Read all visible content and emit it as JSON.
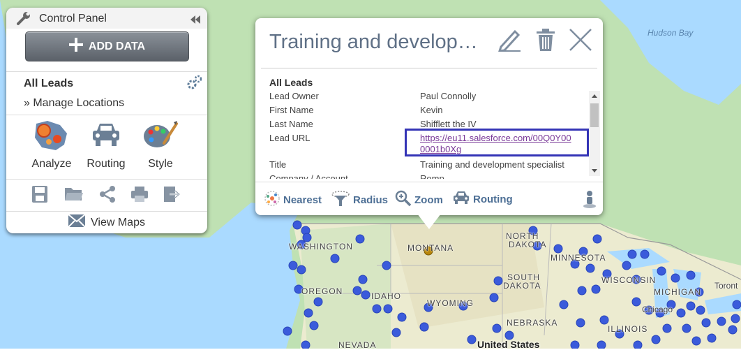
{
  "control_panel": {
    "title": "Control Panel",
    "add_data": "ADD DATA",
    "layer": "All Leads",
    "manage": "» Manage Locations",
    "tools": [
      {
        "label": "Analyze",
        "icon": "analyze-map-icon"
      },
      {
        "label": "Routing",
        "icon": "car-icon"
      },
      {
        "label": "Style",
        "icon": "palette-icon"
      }
    ],
    "view_maps": "View Maps"
  },
  "popup": {
    "title": "Training and develop…",
    "layer": "All Leads",
    "fields": [
      {
        "key": "Lead Owner",
        "value": "Paul Connolly"
      },
      {
        "key": "First Name",
        "value": "Kevin"
      },
      {
        "key": "Last Name",
        "value": "Shifflett the IV"
      },
      {
        "key": "Lead URL",
        "value": "https://eu11.salesforce.com/00Q0Y000001b0Xg"
      },
      {
        "key": "Title",
        "value": "Training and development specialist"
      },
      {
        "key": "Company / Account",
        "value": "Romp"
      }
    ],
    "url_line1": "https://eu11.salesforce.com/00Q0Y00",
    "url_line2": "0001b0Xg",
    "actions": {
      "nearest": "Nearest",
      "radius": "Radius",
      "zoom": "Zoom",
      "routing": "Routing"
    }
  },
  "map": {
    "labels": {
      "washington": "WASHINGTON",
      "oregon": "OREGON",
      "idaho": "IDAHO",
      "montana": "MONTANA",
      "wyoming": "WYOMING",
      "nevada": "NEVADA",
      "north_dakota_1": "NORTH",
      "north_dakota_2": "DAKOTA",
      "south_dakota_1": "SOUTH",
      "south_dakota_2": "DAKOTA",
      "nebraska": "NEBRASKA",
      "minnesota": "MINNESOTA",
      "wisconsin": "WISCONSIN",
      "michigan": "MICHIGAN",
      "illinois": "ILLINOIS",
      "chicago": "Chicago",
      "toronto": "Toront",
      "united_states": "United States",
      "hudson_bay": "Hudson Bay"
    },
    "colors": {
      "marker": "#3b5bdb",
      "selected_marker": "#b8860b",
      "water": "#aadaff",
      "land": "#e8eccf"
    }
  }
}
